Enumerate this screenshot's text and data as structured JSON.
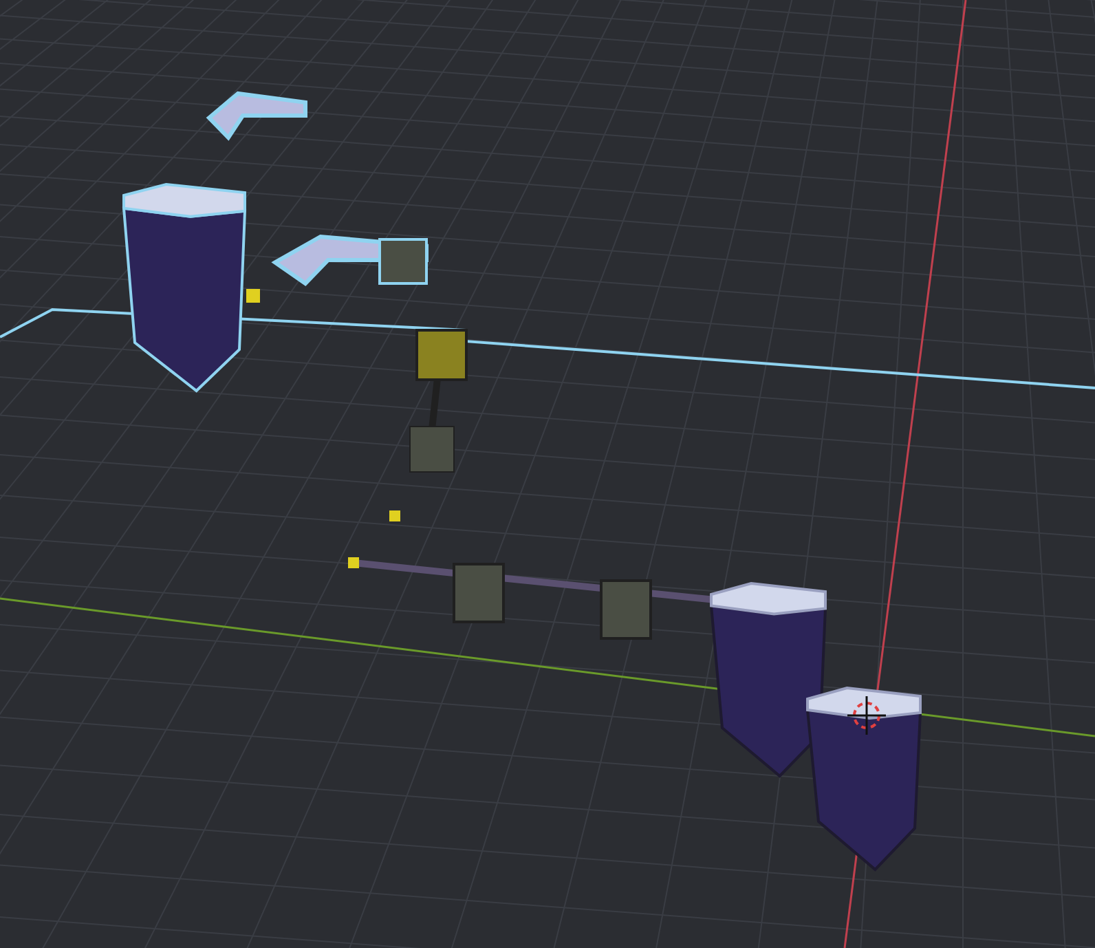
{
  "viewport": {
    "objects": [
      {
        "kind": "platform",
        "selected": true
      },
      {
        "kind": "pillar",
        "selected": true
      },
      {
        "kind": "platform",
        "selected": true
      },
      {
        "kind": "crate",
        "selected": true
      },
      {
        "kind": "crate",
        "selected": false
      },
      {
        "kind": "crate",
        "selected": false
      },
      {
        "kind": "crate",
        "selected": false
      },
      {
        "kind": "pillar",
        "selected": false
      },
      {
        "kind": "pillar",
        "selected": false
      }
    ]
  }
}
